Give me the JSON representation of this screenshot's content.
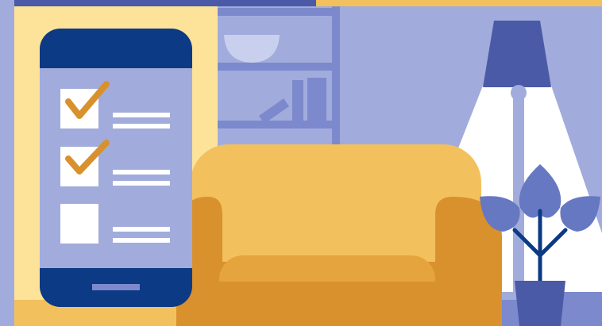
{
  "scene": {
    "description_shown_text": "",
    "colors": {
      "wall_light": "#a1acdc",
      "wall_yellow": "#fde39a",
      "shelf": "#7c89cc",
      "phone_frame": "#0c3a84",
      "phone_screen": "#a1acdc",
      "check_box": "#ffffff",
      "check_mark": "#d9912e",
      "sofa_light": "#f2c15e",
      "sofa_dark": "#d9912e",
      "lamp_shade": "#4a5aa6",
      "lamp_light": "#ffffff",
      "plant_leaf": "#6678c2",
      "plant_stem": "#0c3a84",
      "pot": "#4a5aa6",
      "floor_yellow": "#f2c15e",
      "floor_blue": "#7c89cc"
    },
    "checklist": {
      "items": [
        {
          "checked": true
        },
        {
          "checked": true
        },
        {
          "checked": false
        }
      ]
    },
    "icons": {
      "phone": "smartphone-icon",
      "check": "checkmark-icon",
      "sofa": "sofa-icon",
      "lamp": "floor-lamp-icon",
      "plant": "potted-plant-icon",
      "bowl": "bowl-icon",
      "books": "books-icon"
    }
  }
}
